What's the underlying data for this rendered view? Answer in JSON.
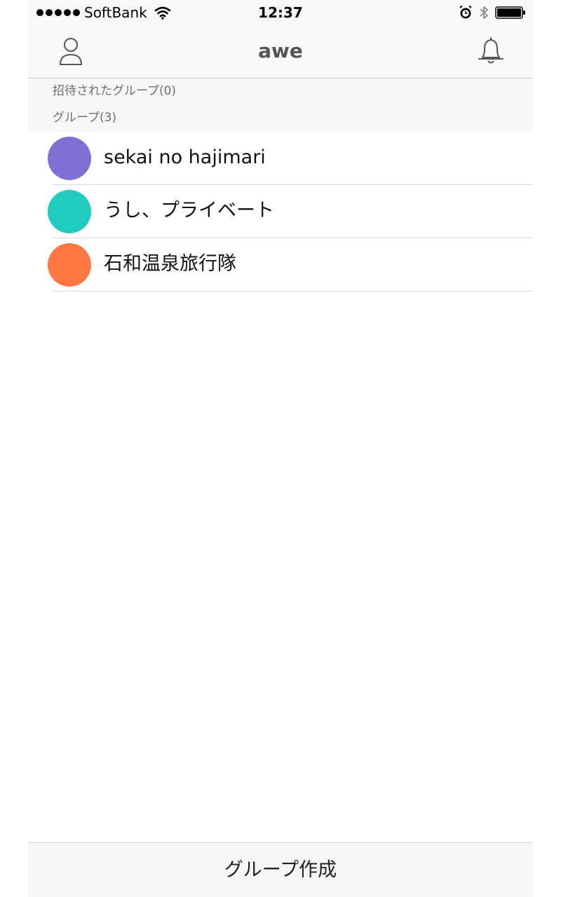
{
  "status_bar": {
    "carrier": "SoftBank",
    "time": "12:37",
    "signal_bars": 5,
    "icons": [
      "signal-dots-icon",
      "wifi-icon",
      "alarm-icon",
      "bluetooth-icon",
      "battery-icon"
    ]
  },
  "nav": {
    "title": "awe",
    "left_icon": "person-icon",
    "right_icon": "bell-icon"
  },
  "sections": {
    "invited": "招待されたグループ(0)",
    "groups": "グループ(3)"
  },
  "groups": [
    {
      "name": "sekai no hajimari",
      "color": "#8070d4"
    },
    {
      "name": "うし、プライベート",
      "color": "#21ccbf"
    },
    {
      "name": "石和温泉旅行隊",
      "color": "#ff7844"
    }
  ],
  "bottom": {
    "create_label": "グループ作成"
  }
}
